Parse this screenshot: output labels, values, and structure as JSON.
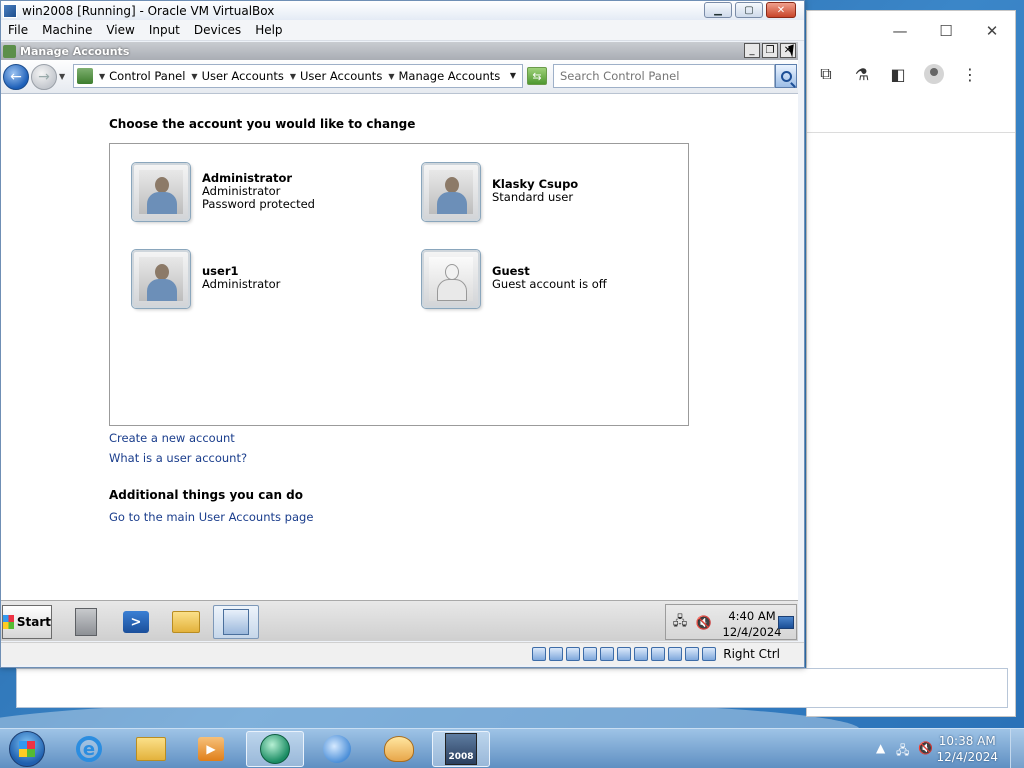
{
  "host": {
    "browser": {
      "controls": {
        "minimize": "—",
        "maximize": "☐",
        "close": "✕"
      },
      "toolbar_icons": [
        "extensions-icon",
        "labs-icon",
        "side-panel-icon",
        "profile-icon",
        "menu-icon"
      ]
    },
    "taskbar": {
      "apps": [
        "internet-explorer",
        "windows-explorer",
        "media-player",
        "app-orb",
        "pen-tool",
        "paint",
        "virtualbox-win2008"
      ],
      "vbox_badge": "2008",
      "clock_time": "10:38 AM",
      "clock_date": "12/4/2024"
    }
  },
  "vbox": {
    "title": "win2008 [Running] - Oracle VM VirtualBox",
    "menus": [
      "File",
      "Machine",
      "View",
      "Input",
      "Devices",
      "Help"
    ],
    "host_key": "Right Ctrl"
  },
  "guest": {
    "window_title": "Manage Accounts",
    "breadcrumb": [
      "Control Panel",
      "User Accounts",
      "User Accounts",
      "Manage Accounts"
    ],
    "search_placeholder": "Search Control Panel",
    "heading": "Choose the account you would like to change",
    "accounts": [
      {
        "name": "Administrator",
        "line1": "Administrator",
        "line2": "Password protected",
        "icon": "user-avatar-icon"
      },
      {
        "name": "Klasky Csupo",
        "line1": "Standard user",
        "line2": "",
        "icon": "user-avatar-icon"
      },
      {
        "name": "user1",
        "line1": "Administrator",
        "line2": "",
        "icon": "user-avatar-icon"
      },
      {
        "name": "Guest",
        "line1": "Guest account is off",
        "line2": "",
        "icon": "guest-avatar-icon"
      }
    ],
    "links": {
      "create_account": "Create a new account",
      "what_is": "What is a user account?",
      "additional_heading": "Additional things you can do",
      "main_page": "Go to the main User Accounts page"
    },
    "taskbar": {
      "start_label": "Start",
      "clock_time": "4:40 AM",
      "clock_date": "12/4/2024"
    }
  }
}
